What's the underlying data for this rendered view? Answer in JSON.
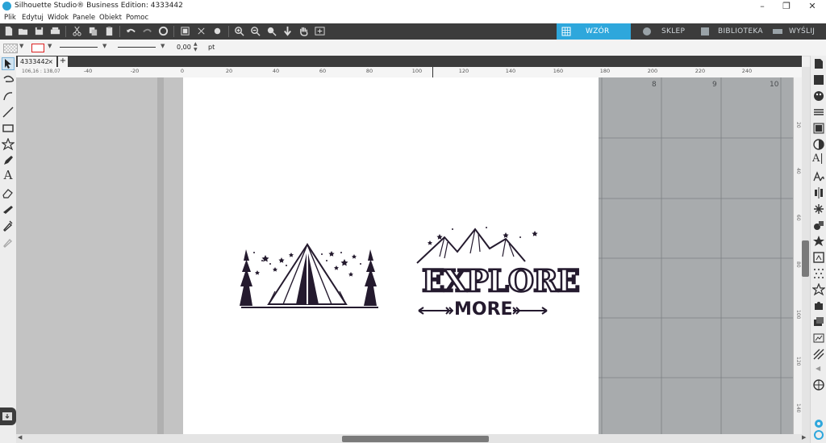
{
  "window": {
    "title": "Silhouette Studio® Business Edition: 4333442"
  },
  "menu": [
    "Plik",
    "Edytuj",
    "Widok",
    "Panele",
    "Obiekt",
    "Pomoc"
  ],
  "nav_tabs": [
    {
      "label": "WZÓR",
      "active": true
    },
    {
      "label": "SKLEP",
      "active": false
    },
    {
      "label": "BIBLIOTEKA",
      "active": false
    },
    {
      "label": "WYŚLIJ",
      "active": false
    }
  ],
  "line_bar": {
    "line_width_value": "0,00",
    "line_width_unit": "pt"
  },
  "document_tab": {
    "name": "4333442",
    "add_label": "+"
  },
  "ruler": {
    "coords": "106,16 : 138,07",
    "top_labels": [
      "-40",
      "-20",
      "0",
      "20",
      "40",
      "60",
      "80",
      "100",
      "120",
      "140",
      "160",
      "180",
      "200",
      "220",
      "240"
    ],
    "side_labels": [
      "20",
      "40",
      "60",
      "80",
      "100",
      "120",
      "140"
    ]
  },
  "grid_labels": [
    "8",
    "9",
    "10"
  ],
  "design": {
    "text_line1": "EXPLORE",
    "text_line2": "MORE"
  },
  "colors": {
    "accent": "#2ea7dc",
    "toolbar": "#3c3c3c",
    "ink": "#241a2e"
  }
}
